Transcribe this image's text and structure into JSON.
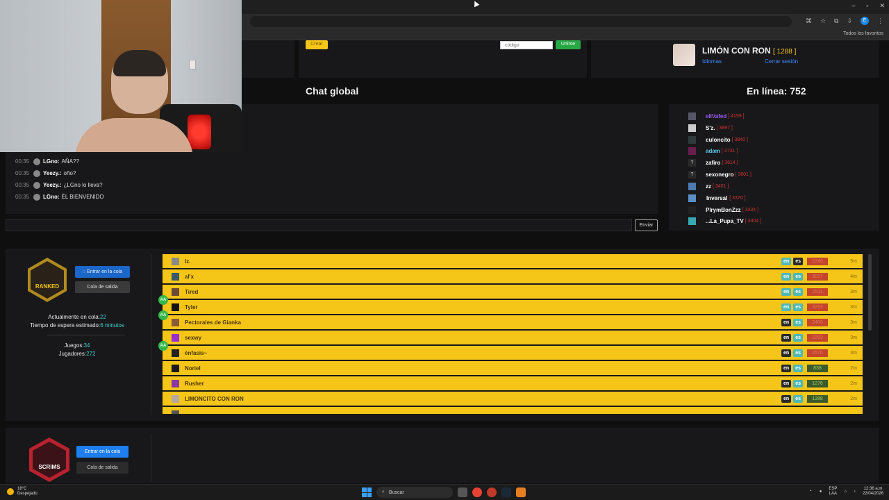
{
  "browser": {
    "bookmarks_label": "Todos los favoritos",
    "profile_initial": "E"
  },
  "top": {
    "create_button": "Crear",
    "code_placeholder": "código",
    "join_button": "Unirse"
  },
  "profile": {
    "name": "LIMÓN CON RON",
    "elo": "[ 1288 ]",
    "languages_link": "Idiomas",
    "logout_link": "Cerrar sesión"
  },
  "chat": {
    "title": "Chat global",
    "send_button": "Enviar",
    "messages": [
      {
        "time": "00:35",
        "user": "LGno:",
        "text": "AÑA??"
      },
      {
        "time": "00:35",
        "user": "Yeezy.:",
        "text": "oño?"
      },
      {
        "time": "00:35",
        "user": "Yeezy.:",
        "text": "¿LGno lo lleva?"
      },
      {
        "time": "00:35",
        "user": "LGno:",
        "text": "ÉL BIENVENIDO"
      }
    ]
  },
  "online": {
    "title": "En línea: 752",
    "users": [
      {
        "name": "elIVafed",
        "elo": "[ 4199 ]"
      },
      {
        "name": "S'z.",
        "elo": "[ 3997 ]"
      },
      {
        "name": "culoncito",
        "elo": "[ 3840 ]"
      },
      {
        "name": "adam",
        "elo": "[ 3731 ]"
      },
      {
        "name": "zafiro",
        "elo": "[ 3614 ]"
      },
      {
        "name": "sexonegro",
        "elo": "[ 3601 ]"
      },
      {
        "name": "zz",
        "elo": "[ 3401 ]"
      },
      {
        "name": "Inversal",
        "elo": "[ 3370 ]"
      },
      {
        "name": "PlrymBonZzz",
        "elo": "[ 3334 ]"
      },
      {
        "name": "...La_Pupa_TV",
        "elo": "[ 3304 ]"
      }
    ]
  },
  "ranked": {
    "badge_text": "RANKED",
    "enter_queue": "Entrar en la cola",
    "leave_queue": "Cola de salida",
    "in_queue_label": "Actualmente en cola:",
    "in_queue_value": "22",
    "wait_label": "Tiempo de espera estimado:",
    "wait_value": "6 minutos",
    "games_label": "Juegos:",
    "games_value": "34",
    "players_label": "Jugadores:",
    "players_value": "272",
    "queue": [
      {
        "name": "Iz.",
        "lang1": "en",
        "lang2": "es",
        "elo": "2740",
        "time": "5m"
      },
      {
        "name": "al'x",
        "lang1": "en",
        "lang2": "es",
        "elo": "3027",
        "time": "4m"
      },
      {
        "name": "Tired",
        "lang1": "en",
        "lang2": "es",
        "elo": "2511",
        "time": "3m"
      },
      {
        "name": "Tyler",
        "lang1": "en",
        "lang2": "es",
        "elo": "3213",
        "time": "3m"
      },
      {
        "name": "Pectorales de Gianka",
        "lang1": "en",
        "lang2": "es",
        "elo": "2486",
        "time": "3m"
      },
      {
        "name": "sexwy",
        "lang1": "en",
        "lang2": "es",
        "elo": "2293",
        "time": "3m"
      },
      {
        "name": "énfasis~",
        "lang1": "en",
        "lang2": "es",
        "elo": "2570",
        "time": "3m"
      },
      {
        "name": "Noriel",
        "lang1": "en",
        "lang2": "es",
        "elo": "838",
        "time": "2m"
      },
      {
        "name": "Rusher",
        "lang1": "en",
        "lang2": "es",
        "elo": "1276",
        "time": "2m"
      },
      {
        "name": "LIMONCITO CON RON",
        "lang1": "en",
        "lang2": "es",
        "elo": "1288",
        "time": "2m"
      }
    ],
    "aa_label": "AA"
  },
  "scrims": {
    "badge_text": "SCRIMS",
    "enter_queue": "Entrar en la cola",
    "leave_queue": "Cola de salida"
  },
  "taskbar": {
    "temp": "18°C",
    "weather": "Despejado",
    "search": "Buscar",
    "lang1": "ESP",
    "lang2": "LAA",
    "time": "12:36 a.m.",
    "date": "22/04/2026"
  }
}
